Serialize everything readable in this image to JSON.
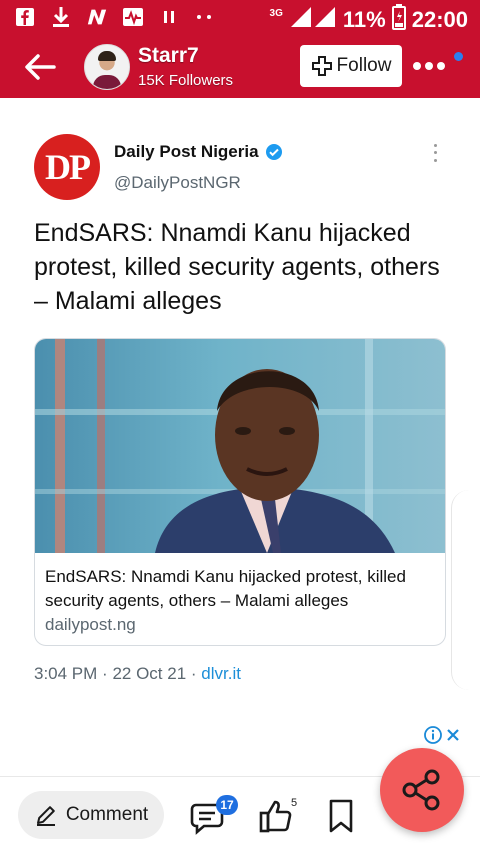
{
  "status_bar": {
    "network": "3G",
    "battery": "11%",
    "time": "22:00"
  },
  "header": {
    "user_name": "Starr7",
    "followers": "15K Followers",
    "follow_label": "Follow"
  },
  "tweet": {
    "account_name": "Daily Post Nigeria",
    "handle": "@DailyPostNGR",
    "logo_text": "DP",
    "text": "EndSARS: Nnamdi Kanu hijacked protest, killed security agents, others – Malami alleges",
    "link_title": "EndSARS: Nnamdi Kanu hijacked protest, killed security agents, others – Malami alleges",
    "link_domain": "dailypost.ng",
    "time": "3:04 PM",
    "date": "22 Oct 21",
    "source": "dlvr.it"
  },
  "bottom_bar": {
    "comment_label": "Comment",
    "comment_count": "17",
    "like_count": "5"
  },
  "colors": {
    "brand_red": "#c8102e",
    "share_button": "#f25a5a",
    "link_blue": "#1d8fd8",
    "badge_blue": "#1f6fe0"
  },
  "icons": [
    "facebook-icon",
    "download-icon",
    "n-app-icon",
    "activity-icon",
    "pause-icon",
    "signal-icon",
    "battery-icon",
    "back-arrow-icon",
    "plus-icon",
    "more-dots-icon",
    "verified-icon",
    "kebab-menu-icon",
    "info-icon",
    "close-icon",
    "edit-pencil-icon",
    "comment-bubble-icon",
    "thumbs-up-icon",
    "bookmark-icon",
    "share-icon"
  ]
}
